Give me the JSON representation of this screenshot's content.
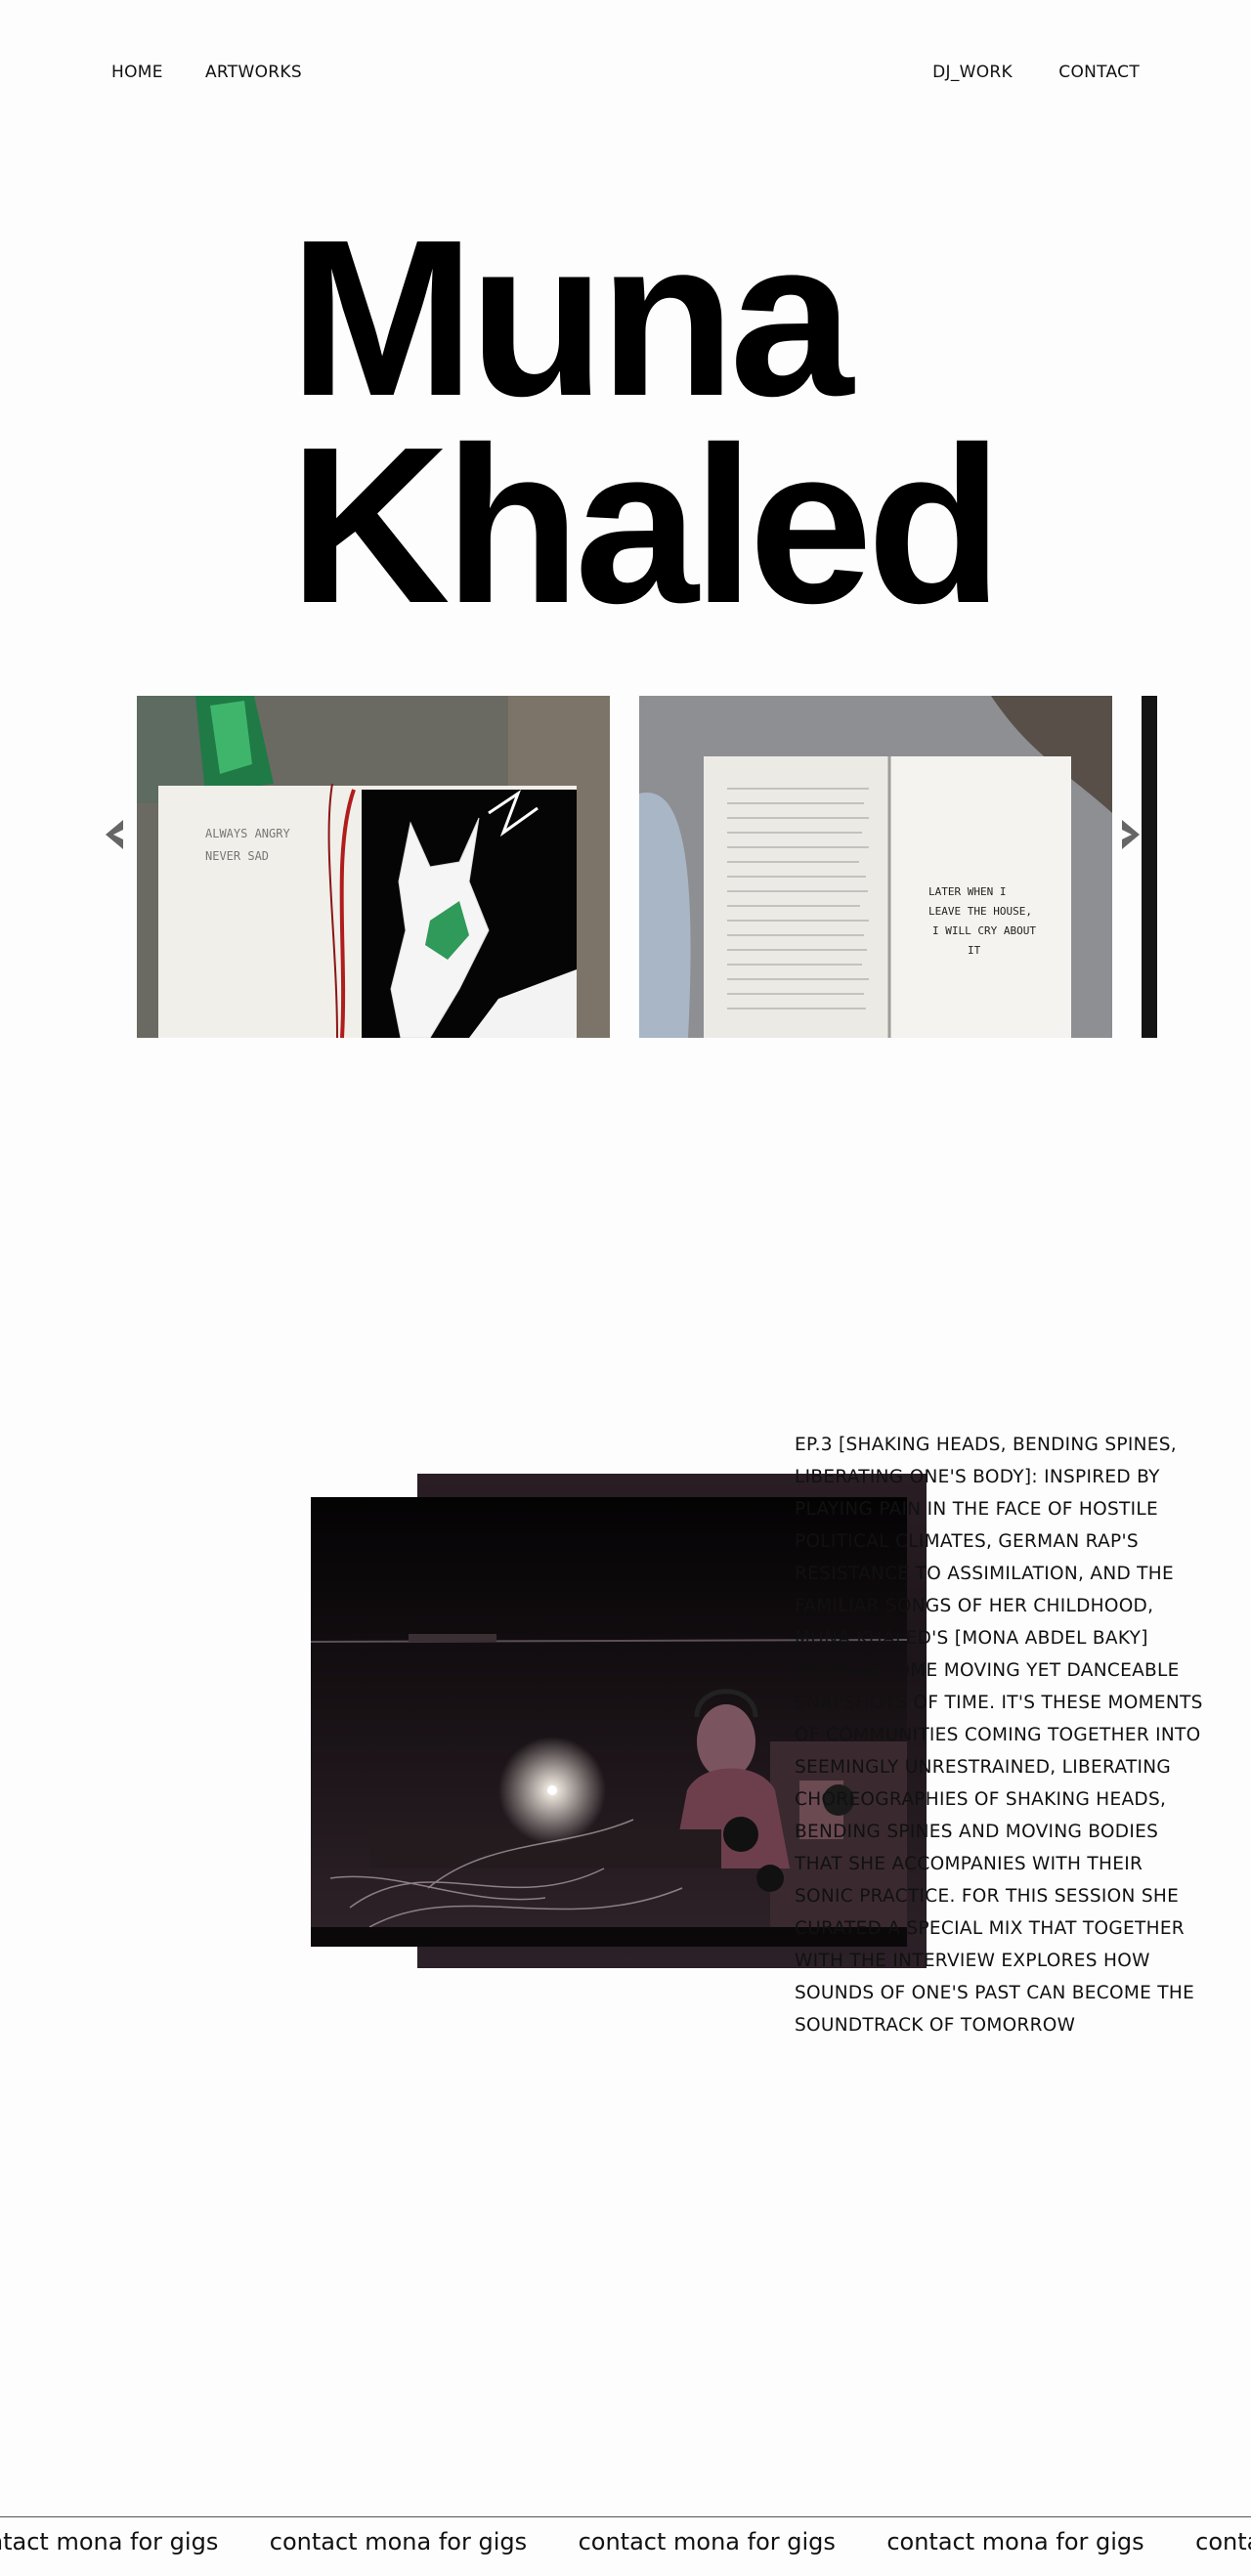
{
  "nav": {
    "home": "HOME",
    "artworks": "ARTWORKS",
    "dj_work": "DJ_WORK",
    "contact": "CONTACT"
  },
  "hero": {
    "line1": "Muna",
    "line2": "Khaled"
  },
  "carousel": {
    "slide1_caption_line1": "ALWAYS ANGRY",
    "slide1_caption_line2": "NEVER SAD",
    "slide2_caption_line1": "LATER WHEN I",
    "slide2_caption_line2": "LEAVE THE HOUSE,",
    "slide2_caption_line3": "I WILL CRY ABOUT",
    "slide2_caption_line4": "IT",
    "prev_icon": "chevron-left-icon",
    "next_icon": "chevron-right-icon"
  },
  "description": "EP.3 [SHAKING HEADS, BENDING SPINES, LIBERATING ONE'S BODY]: INSPIRED BY PLAYING PAIN IN THE FACE OF HOSTILE POLITICAL CLIMATES, GERMAN RAP'S RESISTANCE TO ASSIMILATION, AND THE FAMILIAR SONGS OF HER CHILDHOOD, MUNA KHALED'S [MONA ABDEL BAKY] WORK BECOME MOVING YET DANCEABLE SNAPSHOTS OF TIME. IT'S THESE MOMENTS OF COMMUNITIES COMING TOGETHER INTO SEEMINGLY UNRESTRAINED, LIBERATING CHOREOGRAPHIES OF SHAKING HEADS, BENDING SPINES AND MOVING BODIES THAT SHE ACCOMPANIES WITH THEIR SONIC PRACTICE. FOR THIS SESSION SHE CURATED A SPECIAL MIX THAT TOGETHER WITH THE INTERVIEW EXPLORES HOW SOUNDS OF ONE'S PAST CAN BECOME THE SOUNDTRACK OF TOMORROW",
  "marquee": {
    "text": "contact mona for gigs"
  },
  "colors": {
    "background": "#fdfdfd",
    "text": "#111111",
    "accent_green": "#2f9a5a",
    "thread_red": "#b01d1d"
  }
}
